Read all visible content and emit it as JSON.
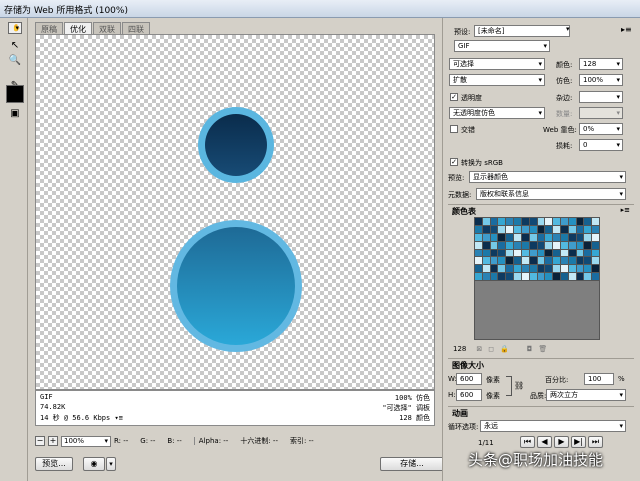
{
  "window": {
    "title": "存储为 Web 所用格式 (100%)"
  },
  "tabs": [
    "原稿",
    "优化",
    "双联",
    "四联"
  ],
  "active_tab": 1,
  "info_left": [
    "GIF",
    "74.82K",
    "14 秒 @ 56.6 Kbps"
  ],
  "info_left_menu": "▾≡",
  "info_right": [
    "100% 仿色",
    "\"可选择\" 调板",
    "128 颜色"
  ],
  "status": {
    "zoom": "100%",
    "r": "R: --",
    "g": "G: --",
    "b": "B: --",
    "alpha": "Alpha: --",
    "hex": "十六进制: --",
    "index": "索引: --"
  },
  "buttons": {
    "preview": "预览...",
    "save": "存储...",
    "cancel": "取消",
    "done": "完成",
    "remember": "存储",
    "zoom_minus": "−",
    "zoom_plus": "+"
  },
  "settings": {
    "preset_label": "预设:",
    "preset_value": "[未命名]",
    "format": "GIF",
    "reduction": "可选择",
    "colors_label": "颜色:",
    "colors_value": "128",
    "dither_algo": "扩散",
    "dither_label": "仿色:",
    "dither_value": "100%",
    "transparency_label": "透明度",
    "transparency_checked": true,
    "matte_label": "杂边:",
    "transparency_dither": "无透明度仿色",
    "amount_label": "数量:",
    "interlaced_label": "交错",
    "interlaced_checked": false,
    "web_snap_label": "Web 靠色:",
    "web_snap_value": "0%",
    "lossy_label": "损耗:",
    "lossy_value": "0",
    "srgb_label": "转换为 sRGB",
    "srgb_checked": true,
    "preview_label": "预览:",
    "preview_value": "显示器颜色",
    "metadata_label": "元数据:",
    "metadata_value": "版权和联系信息"
  },
  "color_table": {
    "title": "颜色表",
    "count": "128"
  },
  "image_size": {
    "title": "图像大小",
    "w_label": "W:",
    "w_value": "600",
    "w_unit": "像素",
    "h_label": "H:",
    "h_value": "600",
    "h_unit": "像素",
    "percent_label": "百分比:",
    "percent_value": "100",
    "percent_unit": "%",
    "quality_label": "品质:",
    "quality_value": "两次立方"
  },
  "animation": {
    "title": "动画",
    "loop_label": "循环选项:",
    "loop_value": "永远",
    "frame": "1/11"
  },
  "watermark": "头条@职场加油技能",
  "colors": {
    "swatch_small": "#0e3a60",
    "swatch_small_ring": "#5ab6e0",
    "swatch_big_top": "#1e6a96",
    "swatch_big_bottom": "#2aa8d8",
    "swatch_big_ring": "#62b8e2",
    "foreground": "#000000"
  }
}
